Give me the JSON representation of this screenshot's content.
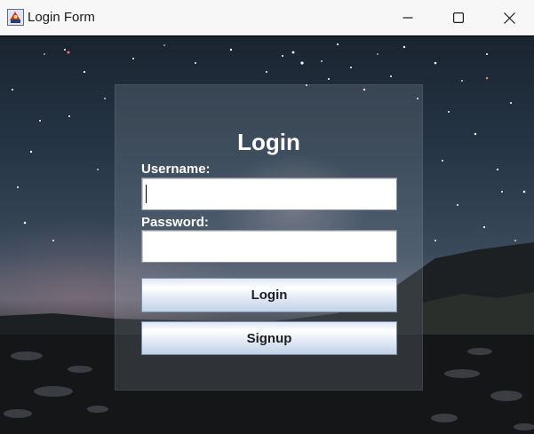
{
  "window": {
    "title": "Login Form",
    "controls": [
      "minimize",
      "maximize",
      "close"
    ]
  },
  "form": {
    "heading": "Login",
    "username_label": "Username:",
    "username_value": "",
    "password_label": "Password:",
    "password_value": "",
    "login_button": "Login",
    "signup_button": "Signup"
  },
  "icons": {
    "app": "java-app-icon",
    "minimize": "minimize-icon",
    "maximize": "maximize-icon",
    "close": "close-icon"
  },
  "colors": {
    "titlebar": "#f7f7f7",
    "button_top": "#dfe7f3",
    "button_bottom": "#c3d2e7",
    "button_border": "#7a8fb0",
    "heading_text": "#ffffff"
  }
}
